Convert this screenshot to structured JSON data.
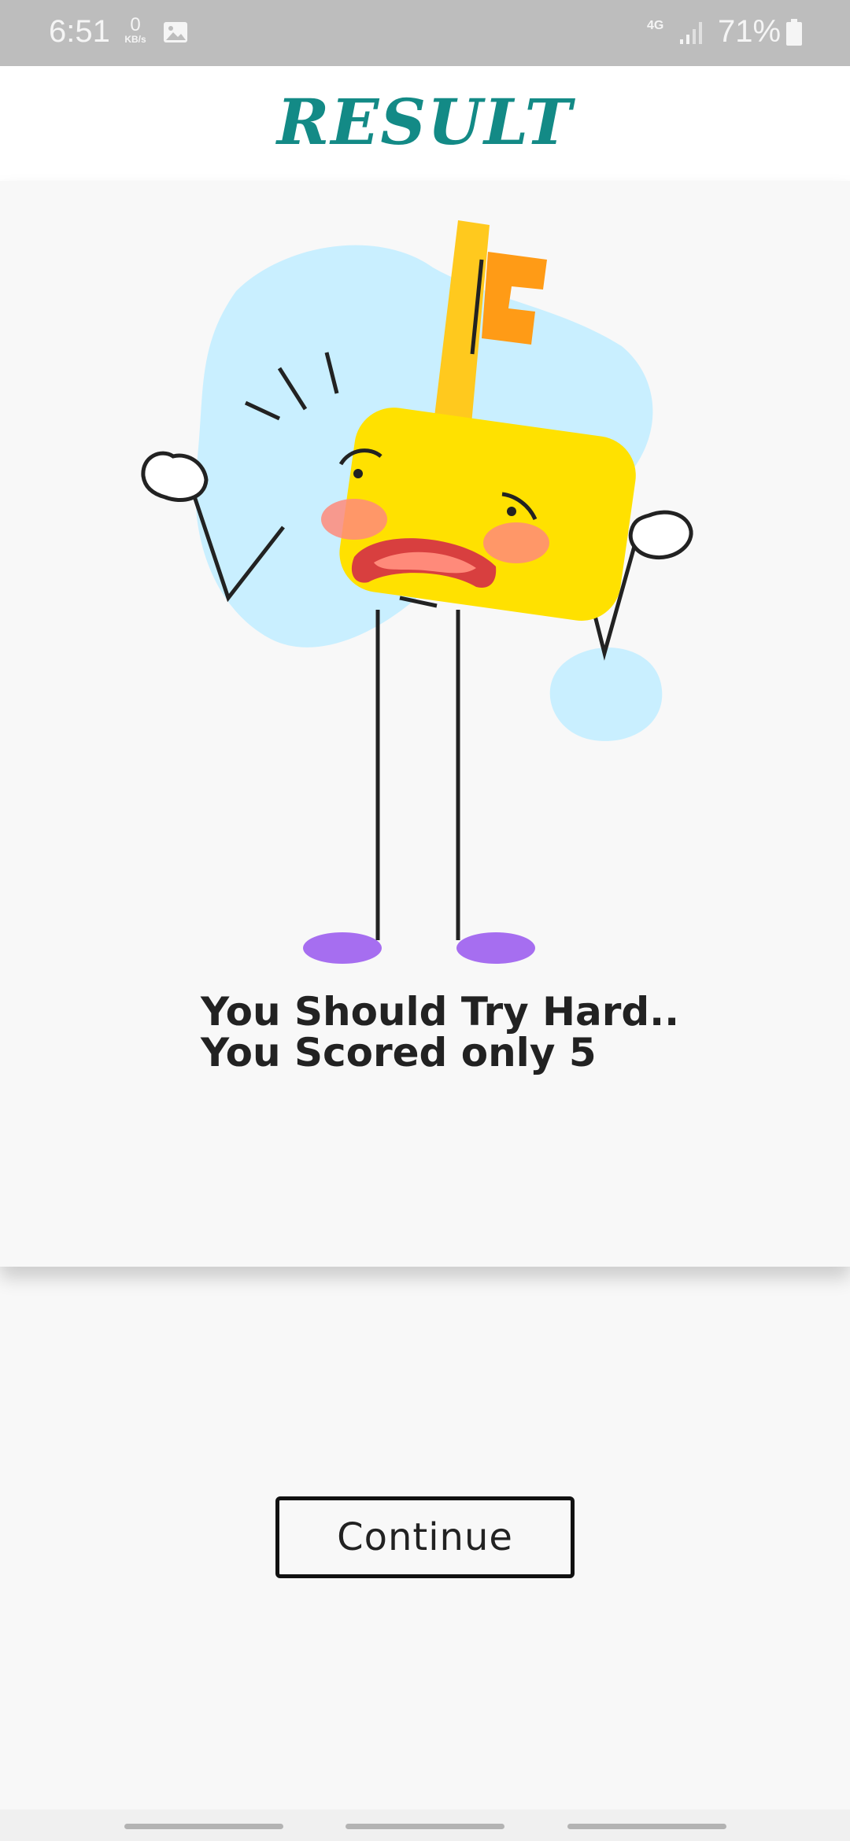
{
  "status_bar": {
    "time": "6:51",
    "data_speed": "0",
    "data_unit": "KB/s",
    "network": "4G",
    "battery": "71%",
    "icons": [
      "image-icon",
      "signal-icon",
      "battery-icon"
    ]
  },
  "header": {
    "title": "RESULT"
  },
  "result": {
    "illustration": "sad-key-character-illustration",
    "line1": "You Should Try Hard..",
    "line2": "You Scored only 5",
    "score": 5
  },
  "actions": {
    "continue_label": "Continue"
  },
  "colors": {
    "title": "#138a86",
    "background": "#f8f8f8",
    "key_yellow": "#ffe100",
    "blob_blue": "#c9efff",
    "shoes": "#a66ef0"
  }
}
